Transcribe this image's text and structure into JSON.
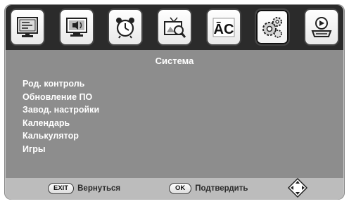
{
  "tabs": [
    {
      "icon": "picture-icon"
    },
    {
      "icon": "sound-icon"
    },
    {
      "icon": "timer-icon"
    },
    {
      "icon": "channel-search-icon"
    },
    {
      "icon": "language-icon",
      "text": "ĀC"
    },
    {
      "icon": "system-gears-icon"
    },
    {
      "icon": "media-player-icon"
    }
  ],
  "content": {
    "title": "Система",
    "items": [
      "Род. контроль",
      "Обновление ПО",
      "Завод. настройки",
      "Календарь",
      "Калькулятор",
      "Игры"
    ]
  },
  "footer": {
    "exit_key": "EXIT",
    "exit_label": "Вернуться",
    "ok_key": "OK",
    "ok_label": "Подтвердить",
    "nav_icon": "dpad-icon"
  }
}
